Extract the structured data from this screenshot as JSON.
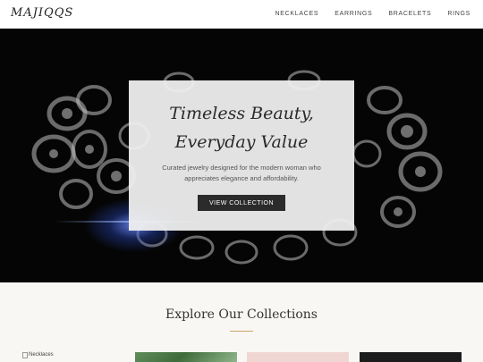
{
  "brand": {
    "logo": "MAJIQQS"
  },
  "nav": {
    "items": [
      "NECKLACES",
      "EARRINGS",
      "BRACELETS",
      "RINGS"
    ]
  },
  "hero": {
    "headline_line1": "Timeless Beauty,",
    "headline_line2": "Everyday Value",
    "subtext": "Curated jewelry designed for the modern woman who appreciates elegance and affordability.",
    "cta_label": "VIEW COLLECTION"
  },
  "collections": {
    "title": "Explore Our Collections",
    "items": [
      {
        "alt": "Necklaces"
      }
    ]
  },
  "colors": {
    "accent": "#c9a46a",
    "dark_button": "#2b2b2b",
    "hero_bg": "#050505"
  }
}
